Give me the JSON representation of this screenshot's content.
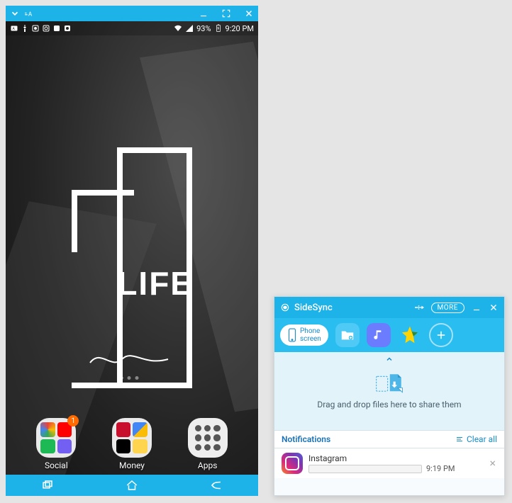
{
  "phone": {
    "status": {
      "battery_pct": "93%",
      "time": "9:20 PM"
    },
    "wallpaper_text": "LIFE",
    "dock": {
      "social": {
        "label": "Social",
        "badge": "1"
      },
      "money": {
        "label": "Money"
      },
      "apps": {
        "label": "Apps"
      }
    }
  },
  "sidesync": {
    "title": "SideSync",
    "more_label": "MORE",
    "phone_screen_btn": "Phone\nscreen",
    "drop_hint": "Drag and drop files here to share them",
    "notifications_label": "Notifications",
    "clear_all_label": "Clear all",
    "notifications": [
      {
        "app": "Instagram",
        "time": "9:19 PM"
      }
    ]
  }
}
